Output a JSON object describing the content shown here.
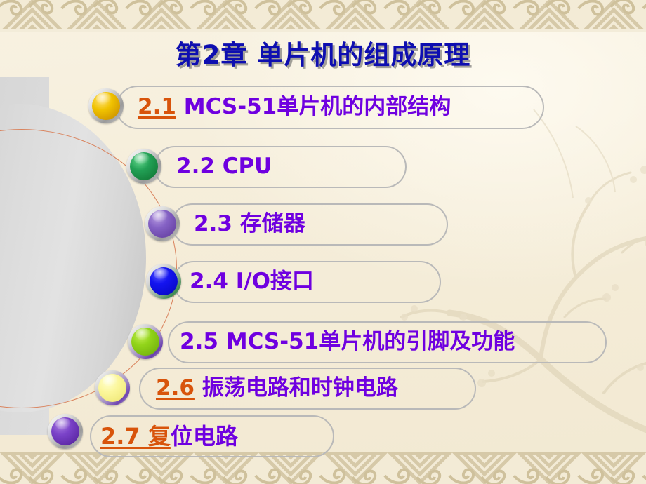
{
  "slide": {
    "title": "第2章  单片机的组成原理",
    "title_color": "#0e0eb0",
    "background_color": "#f5edd9",
    "accent_number_color": "#d8540b",
    "text_color": "#6f00e0"
  },
  "items": [
    {
      "number": "2.1",
      "number_style": "underlined-orange",
      "text": " MCS-51单片机的内部结构",
      "bullet_name": "gold",
      "bullet_color": "#e0ac00",
      "bullet_ring_color": "#b8b8b8"
    },
    {
      "number": "2.2",
      "number_style": "plain-purple",
      "text": " CPU",
      "bullet_name": "green",
      "bullet_color": "#1f9a4d",
      "bullet_ring_color": "#b8b8b8"
    },
    {
      "number": "2.3",
      "number_style": "plain-purple",
      "text": " 存储器",
      "bullet_name": "violet",
      "bullet_color": "#7a56b8",
      "bullet_ring_color": "#b8b8b8"
    },
    {
      "number": "2.4",
      "number_style": "plain-purple",
      "text": "  I/O接口",
      "bullet_name": "blue",
      "bullet_color": "#0a0ae8",
      "bullet_ring_color": "#2f8a4a"
    },
    {
      "number": "2.5",
      "number_style": "plain-purple",
      "text": " MCS-51单片机的引脚及功能",
      "bullet_name": "chartreuse",
      "bullet_color": "#84cc12",
      "bullet_ring_color": "#6f3fb0"
    },
    {
      "number": "2.6",
      "number_style": "underlined-orange",
      "text": " 振荡电路和时钟电路",
      "bullet_name": "pale-yellow",
      "bullet_color": "#fbf69a",
      "bullet_ring_color": "#6f3fb0"
    },
    {
      "number": "2.7  复",
      "number_style": "underlined-orange",
      "text": "位电路",
      "bullet_name": "purple",
      "bullet_color": "#6b32bc",
      "bullet_ring_color": "#b8b8b8"
    }
  ],
  "decor": {
    "top_border": "greek-key-triangle-pattern",
    "bottom_border": "greek-key-triangle-pattern",
    "left_shape": "gray-half-ellipse",
    "left_arc": "thin-orange-arc",
    "watermark": "plum-blossom-branch"
  }
}
